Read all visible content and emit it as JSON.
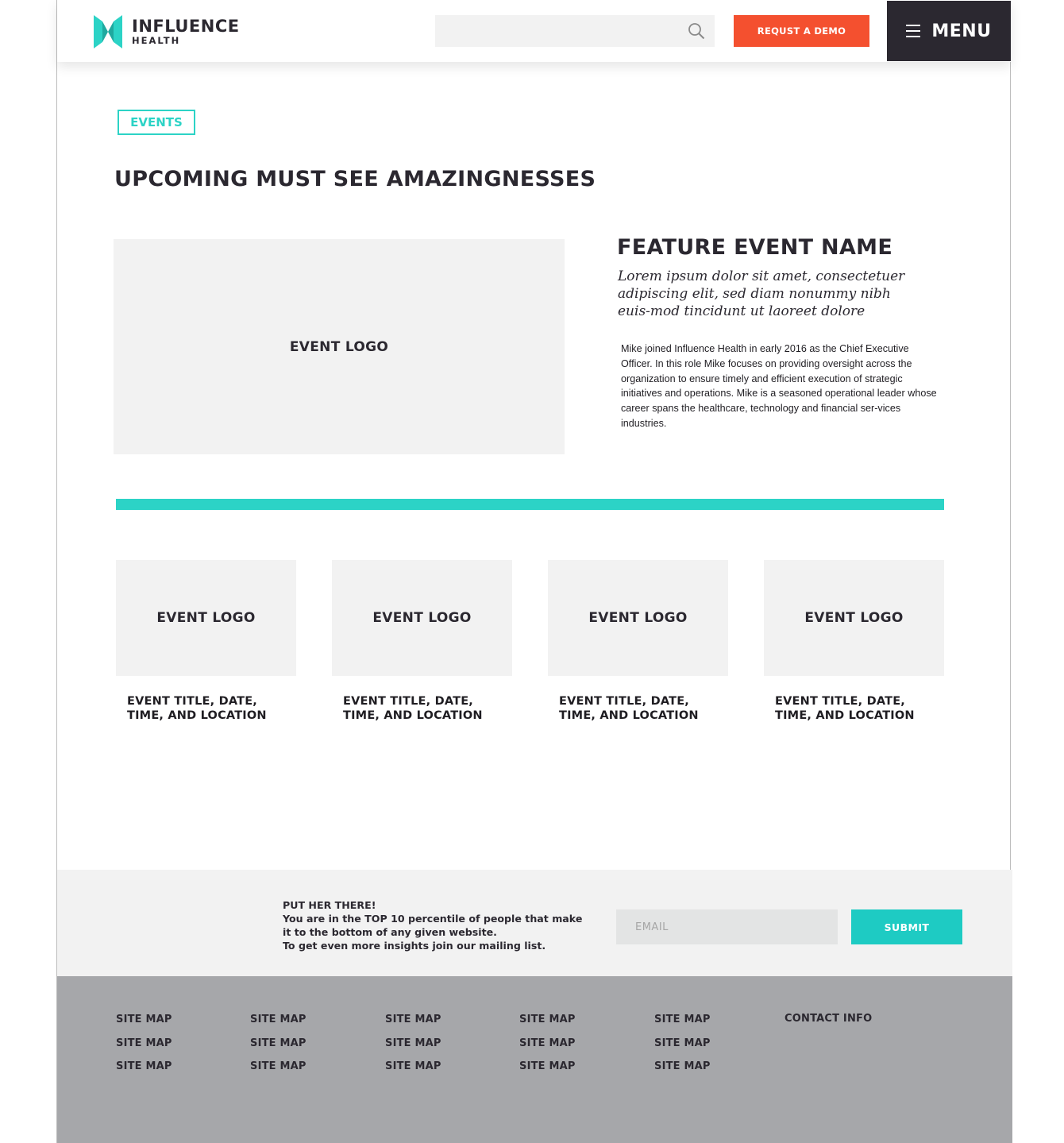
{
  "header": {
    "logo_line1": "INFLUENCE",
    "logo_line2": "HEALTH",
    "search_placeholder": "",
    "demo_label": "REQUST A DEMO",
    "menu_label": "MENU"
  },
  "colors": {
    "accent_teal": "#2cd3c6",
    "demo_orange": "#f4502f",
    "dark": "#2b2830",
    "footer_gray": "#a6a7aa"
  },
  "hero": {
    "tag": "EVENTS",
    "title": "UPCOMING MUST SEE AMAZINGNESSES"
  },
  "feature": {
    "image_label": "EVENT LOGO",
    "name": "FEATURE EVENT NAME",
    "intro": "Lorem ipsum dolor sit amet, consectetuer adipiscing elit, sed diam nonummy nibh euis-mod tincidunt ut laoreet dolore",
    "body": "Mike joined Influence Health in early 2016 as the Chief Executive Officer. In this role Mike focuses on providing oversight across the organization to ensure timely and efficient execution of strategic initiatives and operations. Mike is a seasoned operational leader whose career spans the healthcare, technology and financial ser-vices industries."
  },
  "events": [
    {
      "image_label": "EVENT LOGO",
      "title": "EVENT TITLE, DATE, TIME, AND LOCATION"
    },
    {
      "image_label": "EVENT LOGO",
      "title": "EVENT TITLE, DATE, TIME, AND LOCATION"
    },
    {
      "image_label": "EVENT LOGO",
      "title": "EVENT TITLE, DATE, TIME, AND LOCATION"
    },
    {
      "image_label": "EVENT LOGO",
      "title": "EVENT TITLE, DATE, TIME, AND LOCATION"
    }
  ],
  "newsletter": {
    "line1": "PUT HER THERE!",
    "line2": "You are in the TOP 10 percentile of people that make it to the bottom of any given website.",
    "line3": "To get even more insights join our mailing list.",
    "email_placeholder": "EMAIL",
    "submit_label": "SUBMIT"
  },
  "footer": {
    "columns": [
      [
        "SITE MAP",
        "SITE MAP",
        "SITE MAP"
      ],
      [
        "SITE MAP",
        "SITE MAP",
        "SITE MAP"
      ],
      [
        "SITE MAP",
        "SITE MAP",
        "SITE MAP"
      ],
      [
        "SITE MAP",
        "SITE MAP",
        "SITE MAP"
      ],
      [
        "SITE MAP",
        "SITE MAP",
        "SITE MAP"
      ]
    ],
    "contact_label": "CONTACT INFO"
  },
  "icons": {
    "logo": "influence-health-logo-icon",
    "search": "search-icon",
    "menu": "hamburger-menu-icon"
  }
}
